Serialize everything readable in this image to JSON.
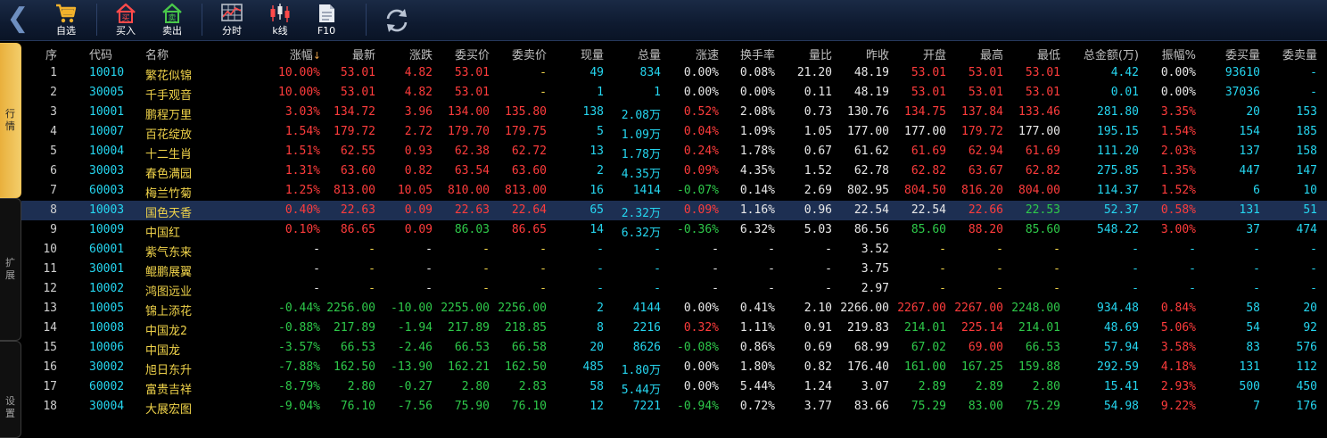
{
  "toolbar": {
    "buttons": [
      {
        "key": "watchlist",
        "label": "自选",
        "icon": "shopping-cart-icon"
      },
      {
        "key": "buy",
        "label": "买入",
        "icon": "house-buy-icon"
      },
      {
        "key": "sell",
        "label": "卖出",
        "icon": "house-sell-icon"
      },
      {
        "key": "timeshare",
        "label": "分时",
        "icon": "timeshare-chart-icon"
      },
      {
        "key": "kline",
        "label": "k线",
        "icon": "candlestick-icon"
      },
      {
        "key": "f10",
        "label": "F10",
        "icon": "document-icon"
      }
    ],
    "buy_glyph": "买",
    "sell_glyph": "卖",
    "refresh_icon": "refresh-icon"
  },
  "sidebar": {
    "tabs": [
      {
        "label": "行情",
        "active": true
      },
      {
        "label": "扩展",
        "active": false
      },
      {
        "label": "设置",
        "active": false
      }
    ]
  },
  "table": {
    "sort_column": "涨幅",
    "sort_icon": "sort-down-arrow-icon",
    "columns": [
      "序",
      "代码",
      "名称",
      "涨幅",
      "最新",
      "涨跌",
      "委买价",
      "委卖价",
      "现量",
      "总量",
      "涨速",
      "换手率",
      "量比",
      "昨收",
      "开盘",
      "最高",
      "最低",
      "总金额(万)",
      "振幅%",
      "委买量",
      "委卖量"
    ],
    "selected_row": 8,
    "rows": [
      [
        "1",
        "10010",
        "繁花似锦",
        "10.00%",
        "53.01",
        "4.82",
        "53.01",
        "-",
        "49",
        "834",
        "0.00%",
        "0.08%",
        "21.20",
        "48.19",
        "53.01",
        "53.01",
        "53.01",
        "4.42",
        "0.00%",
        "93610",
        "-"
      ],
      [
        "2",
        "30005",
        "千手观音",
        "10.00%",
        "53.01",
        "4.82",
        "53.01",
        "-",
        "1",
        "1",
        "0.00%",
        "0.00%",
        "0.11",
        "48.19",
        "53.01",
        "53.01",
        "53.01",
        "0.01",
        "0.00%",
        "37036",
        "-"
      ],
      [
        "3",
        "10001",
        "鹏程万里",
        "3.03%",
        "134.72",
        "3.96",
        "134.00",
        "135.80",
        "138",
        "2.08万",
        "0.52%",
        "2.08%",
        "0.73",
        "130.76",
        "134.75",
        "137.84",
        "133.46",
        "281.80",
        "3.35%",
        "20",
        "153"
      ],
      [
        "4",
        "10007",
        "百花绽放",
        "1.54%",
        "179.72",
        "2.72",
        "179.70",
        "179.75",
        "5",
        "1.09万",
        "0.04%",
        "1.09%",
        "1.05",
        "177.00",
        "177.00",
        "179.72",
        "177.00",
        "195.15",
        "1.54%",
        "154",
        "185"
      ],
      [
        "5",
        "10004",
        "十二生肖",
        "1.51%",
        "62.55",
        "0.93",
        "62.38",
        "62.72",
        "13",
        "1.78万",
        "0.24%",
        "1.78%",
        "0.67",
        "61.62",
        "61.69",
        "62.94",
        "61.69",
        "111.20",
        "2.03%",
        "137",
        "158"
      ],
      [
        "6",
        "30003",
        "春色满园",
        "1.31%",
        "63.60",
        "0.82",
        "63.54",
        "63.60",
        "2",
        "4.35万",
        "0.09%",
        "4.35%",
        "1.52",
        "62.78",
        "62.82",
        "63.67",
        "62.82",
        "275.85",
        "1.35%",
        "447",
        "147"
      ],
      [
        "7",
        "60003",
        "梅兰竹菊",
        "1.25%",
        "813.00",
        "10.05",
        "810.00",
        "813.00",
        "16",
        "1414",
        "-0.07%",
        "0.14%",
        "2.69",
        "802.95",
        "804.50",
        "816.20",
        "804.00",
        "114.37",
        "1.52%",
        "6",
        "10"
      ],
      [
        "8",
        "10003",
        "国色天香",
        "0.40%",
        "22.63",
        "0.09",
        "22.63",
        "22.64",
        "65",
        "2.32万",
        "0.09%",
        "1.16%",
        "0.96",
        "22.54",
        "22.54",
        "22.66",
        "22.53",
        "52.37",
        "0.58%",
        "131",
        "51"
      ],
      [
        "9",
        "10009",
        "中国红",
        "0.10%",
        "86.65",
        "0.09",
        "86.03",
        "86.65",
        "14",
        "6.32万",
        "-0.36%",
        "6.32%",
        "5.03",
        "86.56",
        "85.60",
        "88.20",
        "85.60",
        "548.22",
        "3.00%",
        "37",
        "474"
      ],
      [
        "10",
        "60001",
        "紫气东来",
        "-",
        "-",
        "-",
        "-",
        "-",
        "-",
        "-",
        "-",
        "-",
        "-",
        "3.52",
        "-",
        "-",
        "-",
        "-",
        "-",
        "-",
        "-"
      ],
      [
        "11",
        "30001",
        "鲲鹏展翼",
        "-",
        "-",
        "-",
        "-",
        "-",
        "-",
        "-",
        "-",
        "-",
        "-",
        "3.75",
        "-",
        "-",
        "-",
        "-",
        "-",
        "-",
        "-"
      ],
      [
        "12",
        "10002",
        "鸿图远业",
        "-",
        "-",
        "-",
        "-",
        "-",
        "-",
        "-",
        "-",
        "-",
        "-",
        "2.97",
        "-",
        "-",
        "-",
        "-",
        "-",
        "-",
        "-"
      ],
      [
        "13",
        "10005",
        "锦上添花",
        "-0.44%",
        "2256.00",
        "-10.00",
        "2255.00",
        "2256.00",
        "2",
        "4144",
        "0.00%",
        "0.41%",
        "2.10",
        "2266.00",
        "2267.00",
        "2267.00",
        "2248.00",
        "934.48",
        "0.84%",
        "58",
        "20"
      ],
      [
        "14",
        "10008",
        "中国龙2",
        "-0.88%",
        "217.89",
        "-1.94",
        "217.89",
        "218.85",
        "8",
        "2216",
        "0.32%",
        "1.11%",
        "0.91",
        "219.83",
        "214.01",
        "225.14",
        "214.01",
        "48.69",
        "5.06%",
        "54",
        "92"
      ],
      [
        "15",
        "10006",
        "中国龙",
        "-3.57%",
        "66.53",
        "-2.46",
        "66.53",
        "66.58",
        "20",
        "8626",
        "-0.08%",
        "0.86%",
        "0.69",
        "68.99",
        "67.02",
        "69.00",
        "66.53",
        "57.94",
        "3.58%",
        "83",
        "576"
      ],
      [
        "16",
        "30002",
        "旭日东升",
        "-7.88%",
        "162.50",
        "-13.90",
        "162.21",
        "162.50",
        "485",
        "1.80万",
        "0.00%",
        "1.80%",
        "0.82",
        "176.40",
        "161.00",
        "167.25",
        "159.88",
        "292.59",
        "4.18%",
        "131",
        "112"
      ],
      [
        "17",
        "60002",
        "富贵吉祥",
        "-8.79%",
        "2.80",
        "-0.27",
        "2.80",
        "2.83",
        "58",
        "5.44万",
        "0.00%",
        "5.44%",
        "1.24",
        "3.07",
        "2.89",
        "2.89",
        "2.80",
        "15.41",
        "2.93%",
        "500",
        "450"
      ],
      [
        "18",
        "30004",
        "大展宏图",
        "-9.04%",
        "76.10",
        "-7.56",
        "75.90",
        "76.10",
        "12",
        "7221",
        "-0.94%",
        "0.72%",
        "3.77",
        "83.66",
        "75.29",
        "83.00",
        "75.29",
        "54.98",
        "9.22%",
        "7",
        "176"
      ]
    ]
  },
  "colors": {
    "up": "#ff3c3c",
    "down": "#2ec94a",
    "flat": "#e8e8e8",
    "code": "#25d6f0",
    "name": "#f0d34a",
    "selected_row_bg": "#1d2f52",
    "active_tab": "#f0c050"
  }
}
